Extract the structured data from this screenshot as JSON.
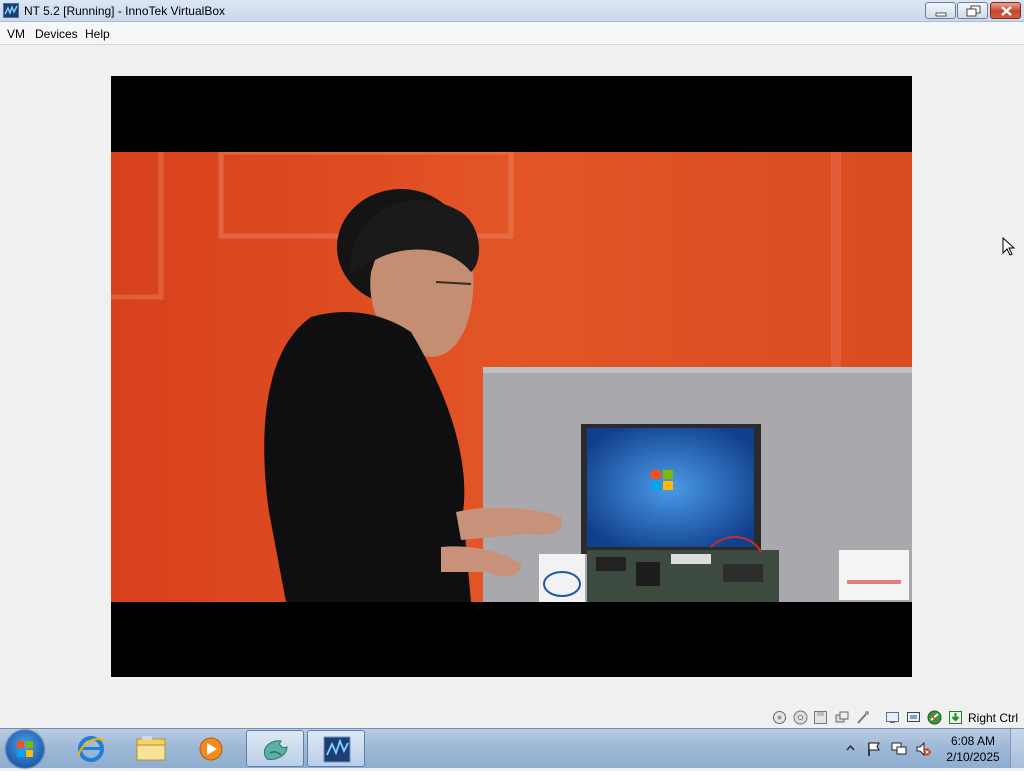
{
  "window": {
    "title": "NT 5.2 [Running] - InnoTek VirtualBox"
  },
  "menu": {
    "items": [
      "VM",
      "Devices",
      "Help"
    ]
  },
  "status_bar": {
    "icons": [
      "hard-disk-icon",
      "optical-disk-icon",
      "floppy-icon",
      "network-icon",
      "usb-icon",
      "shared-folders-icon",
      "display-icon",
      "mouse-integration-icon",
      "capture-icon"
    ],
    "host_key": "Right Ctrl"
  },
  "taskbar": {
    "pinned": [
      "internet-explorer-icon",
      "file-explorer-icon",
      "media-player-icon",
      "app-icon",
      "virtualbox-icon"
    ],
    "clock_time": "6:08 AM",
    "clock_date": "2/10/2025"
  },
  "colors": {
    "titlebar": "#d3e0ef",
    "guest_bg": "#f0f0f0",
    "video_bg": "#000000",
    "scene_accent": "#e04e22",
    "taskbar": "#a9c1dd"
  }
}
